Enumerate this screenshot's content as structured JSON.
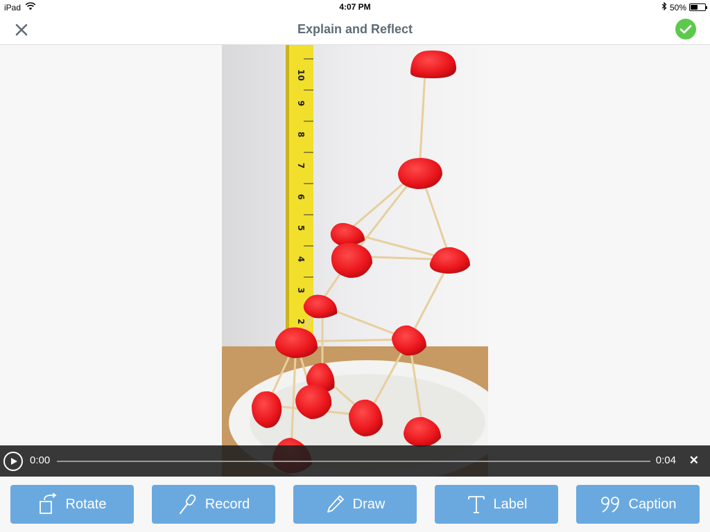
{
  "status_bar": {
    "device": "iPad",
    "time": "4:07 PM",
    "battery_text": "50%",
    "battery_level": 0.5,
    "icons": [
      "wifi-icon",
      "bluetooth-icon",
      "battery-icon"
    ]
  },
  "nav": {
    "title": "Explain and Reflect",
    "close_icon": "close-icon",
    "done_icon": "checkmark-icon"
  },
  "colors": {
    "accent": "#6aa9e0",
    "done_green": "#5cc94c",
    "title_gray": "#5f6b75",
    "player_bg": "#1e1e1e"
  },
  "player": {
    "current_time": "0:00",
    "duration": "0:04",
    "progress": 0
  },
  "ruler": {
    "numbers": [
      "10",
      "9",
      "8",
      "7",
      "6",
      "5",
      "4",
      "3",
      "2"
    ]
  },
  "toolbar": {
    "buttons": [
      {
        "label": "Rotate",
        "icon": "rotate-icon"
      },
      {
        "label": "Record",
        "icon": "microphone-icon"
      },
      {
        "label": "Draw",
        "icon": "pencil-icon"
      },
      {
        "label": "Label",
        "icon": "text-icon"
      },
      {
        "label": "Caption",
        "icon": "quote-icon"
      }
    ]
  }
}
